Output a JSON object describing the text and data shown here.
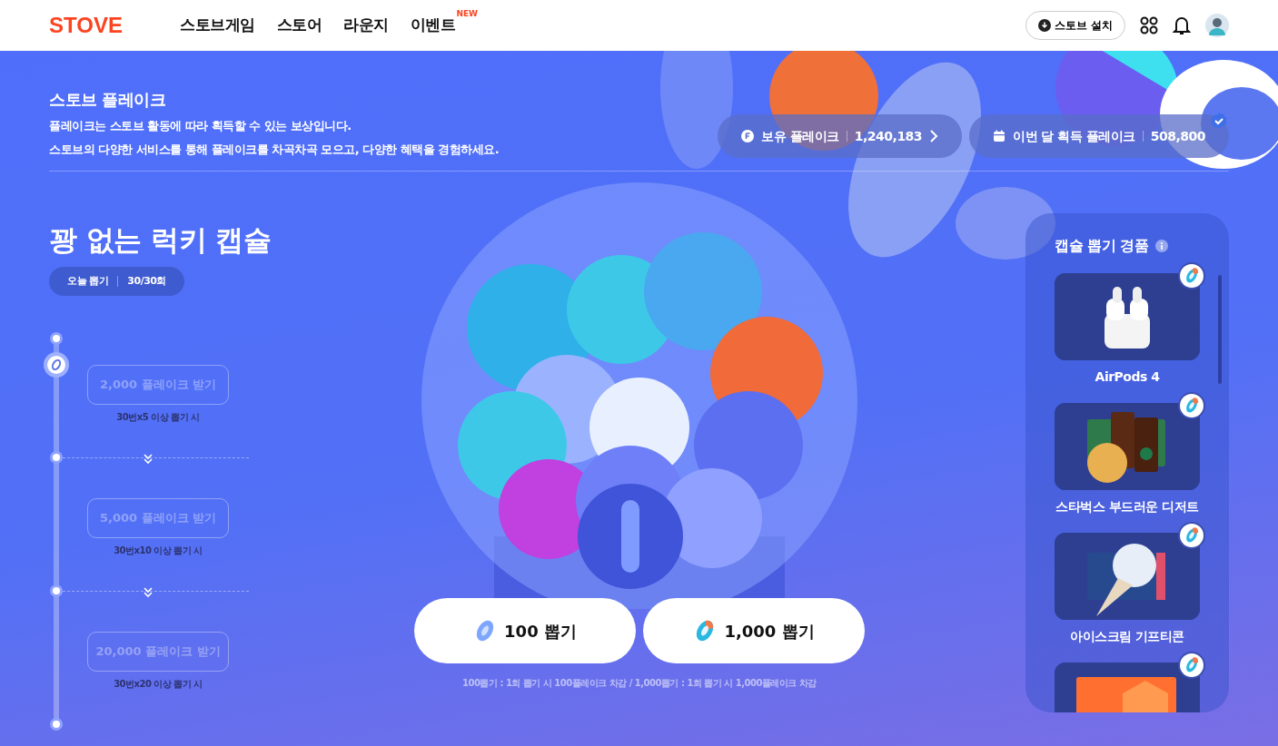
{
  "header": {
    "logo": "STOVE",
    "nav": [
      {
        "label": "스토브게임"
      },
      {
        "label": "스토어"
      },
      {
        "label": "라운지"
      },
      {
        "label": "이벤트",
        "badge": "NEW"
      }
    ],
    "install_button": "스토브 설치"
  },
  "intro": {
    "title": "스토브 플레이크",
    "lines": [
      "플레이크는 스토브 활동에 따라 획득할 수 있는 보상입니다.",
      "스토브의 다양한 서비스를 통해 플레이크를 차곡차곡 모으고, 다양한 혜택을 경험하세요."
    ]
  },
  "stats": [
    {
      "kind": "balance",
      "label": "보유 플레이크",
      "value": "1,240,183"
    },
    {
      "kind": "monthly",
      "label": "이번 달 획득 플레이크",
      "value": "508,800"
    }
  ],
  "capsule": {
    "title": "꽝 없는 럭키 캡슐",
    "today": {
      "label": "오늘 뽑기",
      "value": "30/30회"
    },
    "milestones": [
      {
        "reward": "2,000 플레이크 받기",
        "condition": "30번**x5** 이상 뽑기 시",
        "disabled": true
      },
      {
        "reward": "5,000 플레이크 받기",
        "condition": "30번**x10** 이상 뽑기 시",
        "disabled": true
      },
      {
        "reward": "20,000 플레이크 받기",
        "condition": "30번**x20** 이상 뽑기 시",
        "disabled": true
      }
    ],
    "draw_buttons": [
      {
        "kind": "basic",
        "label": "100 뽑기"
      },
      {
        "kind": "premium",
        "label": "1,000 뽑기"
      }
    ],
    "note": "100뽑기 : 1회 뽑기 시 100플레이크 차감 / 1,000뽑기 : 1회 뽑기 시 1,000플레이크 차감"
  },
  "prizes": {
    "title": "캡슐 뽑기 경품",
    "items": [
      {
        "kind": "picture",
        "name": "AirPods 4"
      },
      {
        "kind": "picture",
        "name": "스타벅스 부드러운 디저트"
      },
      {
        "kind": "picture",
        "name": "아이스크림 기프티콘"
      },
      {
        "kind": "picture"
      }
    ]
  }
}
